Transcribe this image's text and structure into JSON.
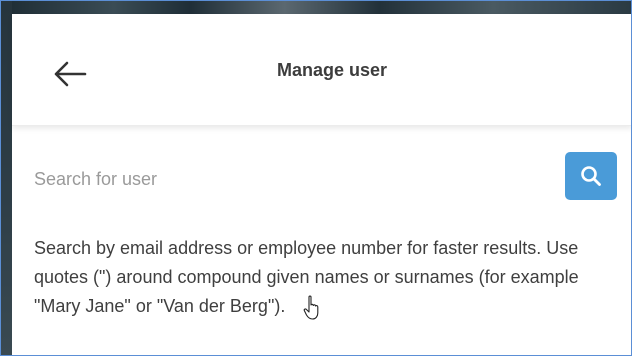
{
  "header": {
    "title": "Manage user",
    "back_icon": "arrow-left-icon"
  },
  "search": {
    "placeholder": "Search for user",
    "value": "",
    "button_icon": "search-icon",
    "button_color": "#4a9bd8"
  },
  "help_text": "Search by email address or employee number for faster results. Use quotes (\") around compound given names or surnames (for example \"Mary Jane\" or \"Van der Berg\")."
}
